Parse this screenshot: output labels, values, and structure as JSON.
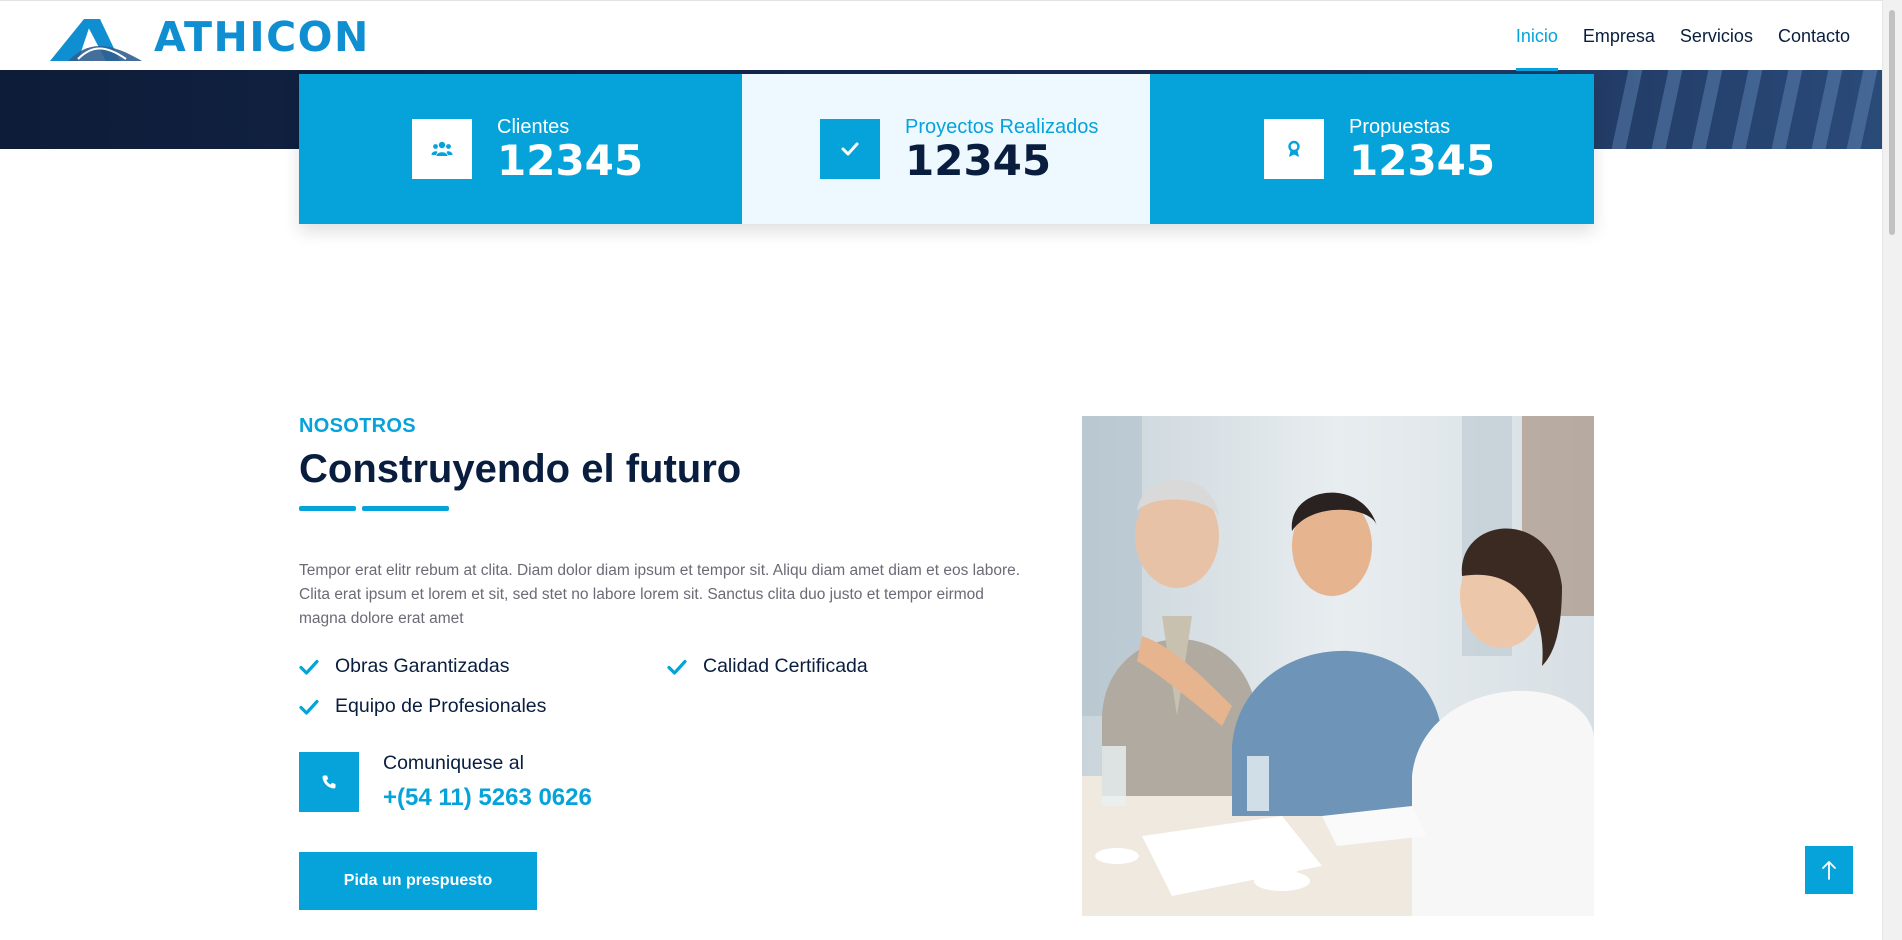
{
  "brand": {
    "name": "ATHICON"
  },
  "nav": {
    "items": [
      {
        "label": "Inicio",
        "active": true
      },
      {
        "label": "Empresa",
        "active": false
      },
      {
        "label": "Servicios",
        "active": false
      },
      {
        "label": "Contacto",
        "active": false
      }
    ]
  },
  "stats": [
    {
      "label": "Clientes",
      "value": "12345",
      "icon": "users-icon"
    },
    {
      "label": "Proyectos Realizados",
      "value": "12345",
      "icon": "check-icon"
    },
    {
      "label": "Propuestas",
      "value": "12345",
      "icon": "award-icon"
    }
  ],
  "about": {
    "kicker": "NOSOTROS",
    "title": "Construyendo el futuro",
    "body": "Tempor erat elitr rebum at clita. Diam dolor diam ipsum et tempor sit. Aliqu diam amet diam et eos labore. Clita erat ipsum et lorem et sit, sed stet no labore lorem sit. Sanctus clita duo justo et tempor eirmod magna dolore erat amet",
    "features": [
      "Obras Garantizadas",
      "Calidad Certificada",
      "Equipo de Profesionales"
    ],
    "contact": {
      "label": "Comuniquese al",
      "phone": "+(54 11) 5263 0626"
    },
    "cta": "Pida un prespuesto"
  },
  "colors": {
    "primary": "#06a3da",
    "dark": "#091e3e",
    "light": "#eef9ff"
  }
}
